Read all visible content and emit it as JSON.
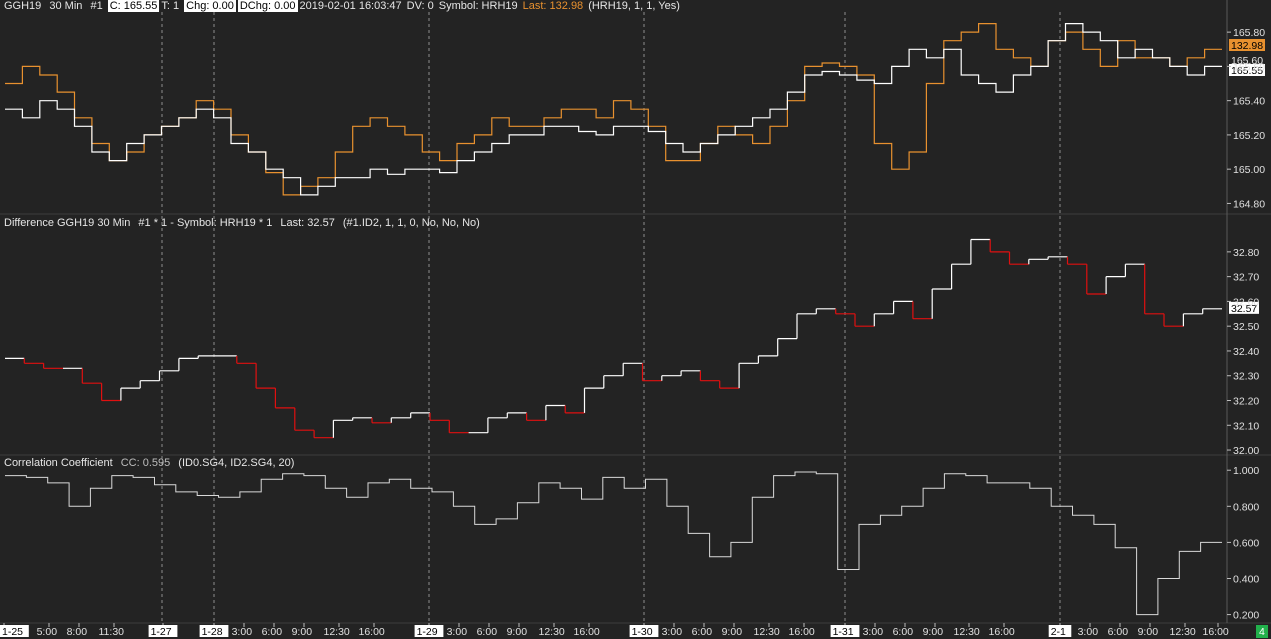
{
  "panel1": {
    "symbol": "GGH19",
    "interval": "30 Min",
    "id": "#1",
    "close": "C: 165.55",
    "ticks": "T: 1",
    "chg": "Chg: 0.00",
    "dchg": "DChg: 0.00",
    "datetime": "2019-02-01 16:03:47",
    "dv": "DV: 0",
    "symbol2": "Symbol: HRH19",
    "last2": "Last: 132.98",
    "params": "(HRH19, 1, 1, Yes)"
  },
  "panel2": {
    "title": "Difference GGH19  30 Min",
    "formula": "#1 * 1 - Symbol: HRH19 * 1",
    "last": "Last: 32.57",
    "params": "(#1.ID2, 1, 1, 0, No, No, No)"
  },
  "panel3": {
    "title": "Correlation Coefficient",
    "cc": "CC: 0.595",
    "params": "(ID0.SG4, ID2.SG4, 20)"
  },
  "colors": {
    "background": "#232323",
    "ggh19": "#ffffff",
    "hrh19": "#e8912f",
    "diff_up": "#ffffff",
    "diff_down": "#e01010",
    "correlation": "#d9d9d9",
    "grid": "#8c8c8c",
    "badge_green": "#22b14c"
  },
  "chart_data": [
    {
      "type": "line",
      "title": "GGH19 30 Min",
      "series": [
        {
          "name": "GGH19",
          "color": "#ffffff",
          "values": [
            165.35,
            165.3,
            165.4,
            165.35,
            165.25,
            165.1,
            165.05,
            165.15,
            165.2,
            165.25,
            165.3,
            165.35,
            165.3,
            165.15,
            165.1,
            165.0,
            164.95,
            164.85,
            164.9,
            164.95,
            164.95,
            165.0,
            164.97,
            165.0,
            165.0,
            164.98,
            165.05,
            165.1,
            165.15,
            165.2,
            165.2,
            165.25,
            165.25,
            165.22,
            165.2,
            165.25,
            165.25,
            165.22,
            165.15,
            165.1,
            165.15,
            165.2,
            165.25,
            165.3,
            165.35,
            165.45,
            165.55,
            165.57,
            165.55,
            165.52,
            165.5,
            165.6,
            165.7,
            165.65,
            165.7,
            165.55,
            165.5,
            165.45,
            165.55,
            165.6,
            165.75,
            165.85,
            165.8,
            165.75,
            165.65,
            165.7,
            165.65,
            165.6,
            165.55,
            165.6
          ]
        },
        {
          "name": "HRH19",
          "color": "#e8912f",
          "values": [
            165.5,
            165.6,
            165.55,
            165.45,
            165.3,
            165.15,
            165.05,
            165.1,
            165.2,
            165.25,
            165.3,
            165.4,
            165.35,
            165.2,
            165.1,
            164.98,
            164.85,
            164.9,
            164.95,
            165.1,
            165.25,
            165.3,
            165.25,
            165.2,
            165.1,
            165.05,
            165.15,
            165.2,
            165.3,
            165.25,
            165.25,
            165.3,
            165.35,
            165.35,
            165.3,
            165.4,
            165.35,
            165.25,
            165.05,
            165.05,
            165.15,
            165.25,
            165.2,
            165.15,
            165.25,
            165.4,
            165.6,
            165.62,
            165.6,
            165.55,
            165.15,
            165.0,
            165.1,
            165.5,
            165.75,
            165.8,
            165.85,
            165.7,
            165.65,
            165.6,
            165.75,
            165.8,
            165.7,
            165.6,
            165.75,
            165.65,
            165.65,
            165.6,
            165.65,
            165.7
          ]
        }
      ],
      "ylim": [
        164.75,
        165.9
      ],
      "y_ticks": [
        "165.80",
        "165.60",
        "165.40",
        "165.20",
        "165.00",
        "164.80"
      ],
      "last_labels": [
        "132.98",
        "165.60",
        "165.55"
      ]
    },
    {
      "type": "line",
      "title": "Difference GGH19 30 Min",
      "series": [
        {
          "name": "Difference",
          "values": [
            32.37,
            32.35,
            32.33,
            32.33,
            32.27,
            32.2,
            32.25,
            32.28,
            32.32,
            32.37,
            32.38,
            32.38,
            32.35,
            32.25,
            32.17,
            32.08,
            32.05,
            32.12,
            32.13,
            32.11,
            32.13,
            32.15,
            32.12,
            32.07,
            32.07,
            32.13,
            32.15,
            32.12,
            32.18,
            32.15,
            32.25,
            32.3,
            32.35,
            32.28,
            32.3,
            32.32,
            32.28,
            32.25,
            32.35,
            32.38,
            32.45,
            32.55,
            32.57,
            32.55,
            32.5,
            32.55,
            32.6,
            32.53,
            32.65,
            32.75,
            32.85,
            32.8,
            32.75,
            32.77,
            32.78,
            32.75,
            32.63,
            32.7,
            32.75,
            32.55,
            32.5,
            32.55,
            32.57
          ]
        }
      ],
      "ylim": [
        31.98,
        32.86
      ],
      "y_ticks": [
        "32.80",
        "32.70",
        "32.60",
        "32.50",
        "32.40",
        "32.30",
        "32.20",
        "32.10",
        "32.00"
      ],
      "last_label": "32.57"
    },
    {
      "type": "line",
      "title": "Correlation Coefficient",
      "series": [
        {
          "name": "Correlation Coefficient",
          "values": [
            0.97,
            0.96,
            0.93,
            0.8,
            0.9,
            0.97,
            0.96,
            0.92,
            0.88,
            0.86,
            0.85,
            0.88,
            0.95,
            0.98,
            0.97,
            0.9,
            0.85,
            0.93,
            0.95,
            0.9,
            0.88,
            0.8,
            0.7,
            0.73,
            0.82,
            0.93,
            0.9,
            0.84,
            0.96,
            0.9,
            0.95,
            0.8,
            0.65,
            0.52,
            0.6,
            0.85,
            0.97,
            0.99,
            0.98,
            0.45,
            0.7,
            0.75,
            0.8,
            0.9,
            0.98,
            0.97,
            0.93,
            0.93,
            0.9,
            0.8,
            0.75,
            0.7,
            0.57,
            0.2,
            0.4,
            0.55,
            0.6
          ]
        }
      ],
      "ylim": [
        0.17,
        1.04
      ],
      "y_ticks": [
        "1.000",
        "0.800",
        "0.600",
        "0.400",
        "0.200"
      ]
    }
  ],
  "time_axis": {
    "labels": [
      "1-25",
      "5:00",
      "8:00",
      "11:30",
      "1-27",
      "1-28",
      "3:00",
      "6:00",
      "9:00",
      "12:30",
      "16:00",
      "1-29",
      "3:00",
      "6:00",
      "9:00",
      "12:30",
      "16:00",
      "1-30",
      "3:00",
      "6:00",
      "9:00",
      "12:30",
      "16:00",
      "1-31",
      "3:00",
      "6:00",
      "9:00",
      "12:30",
      "16:00",
      "2-1",
      "3:00",
      "6:00",
      "9:00",
      "12:30",
      "16:00"
    ],
    "date_labels": [
      "1-25",
      "1-27",
      "1-28",
      "1-29",
      "1-30",
      "1-31",
      "2-1"
    ],
    "badge": "4"
  }
}
